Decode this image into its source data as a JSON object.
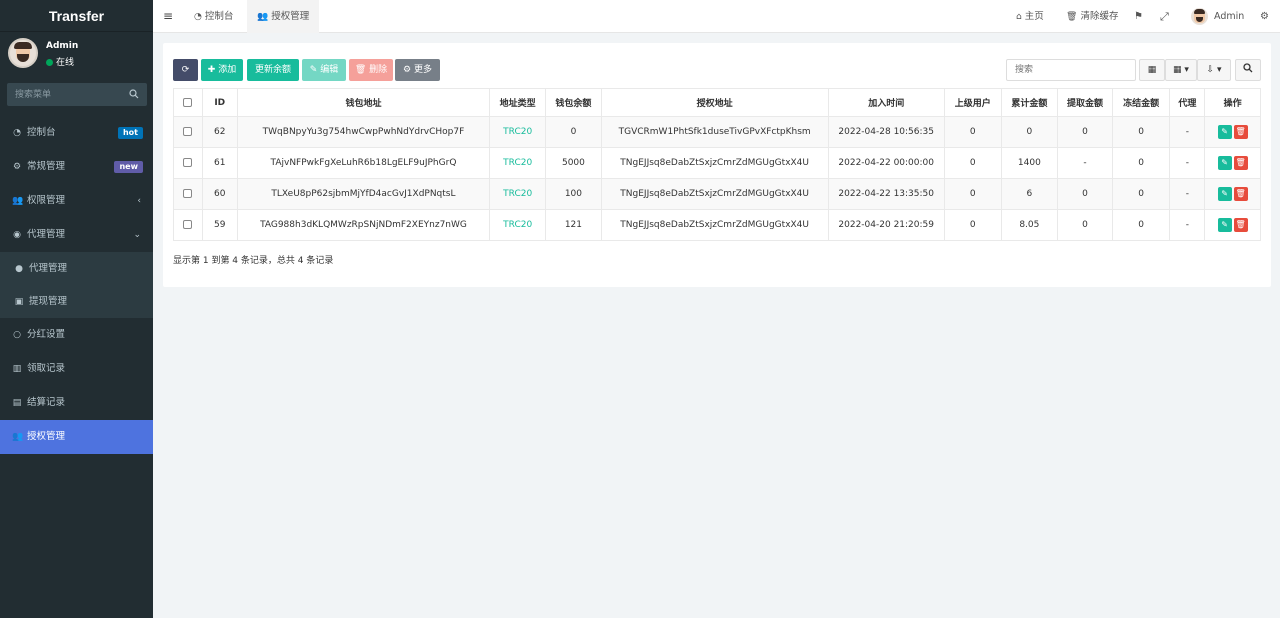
{
  "app": {
    "title": "Transfer"
  },
  "user": {
    "name": "Admin",
    "status": "在线"
  },
  "sidebar": {
    "search_placeholder": "搜索菜单",
    "items": [
      {
        "label": "控制台",
        "icon": "dashboard-icon",
        "badge": "hot",
        "badge_color": "#0073b7"
      },
      {
        "label": "常规管理",
        "icon": "cogs-icon",
        "badge": "new",
        "badge_color": "#605ca8"
      },
      {
        "label": "权限管理",
        "icon": "users-icon",
        "arrow": "‹"
      },
      {
        "label": "代理管理",
        "icon": "user-circle-icon",
        "arrow": "⌄"
      },
      {
        "label": "代理管理",
        "icon": "user-icon",
        "sub": true
      },
      {
        "label": "提现管理",
        "icon": "money-icon",
        "sub": true
      },
      {
        "label": "分红设置",
        "icon": "circle-icon"
      },
      {
        "label": "领取记录",
        "icon": "tasks-icon"
      },
      {
        "label": "结算记录",
        "icon": "list-icon"
      },
      {
        "label": "授权管理",
        "icon": "users-icon",
        "active": true
      }
    ]
  },
  "topbar": {
    "tabs": [
      {
        "label": "控制台"
      },
      {
        "label": "授权管理"
      }
    ],
    "right": {
      "home": "主页",
      "clear_cache": "清除缓存",
      "admin": "Admin"
    }
  },
  "toolbar": {
    "add": "添加",
    "update_balance": "更新余额",
    "edit": "编辑",
    "delete": "删除",
    "more": "更多",
    "search_placeholder": "搜索"
  },
  "table": {
    "columns": [
      "ID",
      "钱包地址",
      "地址类型",
      "钱包余额",
      "授权地址",
      "加入时间",
      "上级用户",
      "累计金额",
      "提取金额",
      "冻结金额",
      "代理",
      "操作"
    ],
    "rows": [
      {
        "id": "62",
        "wallet": "TWqBNpyYu3g754hwCwpPwhNdYdrvCHop7F",
        "type": "TRC20",
        "balance": "0",
        "auth": "TGVCRmW1PhtSfk1duseTivGPvXFctpKhsm",
        "time": "2022-04-28 10:56:35",
        "parent": "0",
        "total": "0",
        "withdrawn": "0",
        "frozen": "0",
        "agent": "-"
      },
      {
        "id": "61",
        "wallet": "TAjvNFPwkFgXeLuhR6b18LgELF9uJPhGrQ",
        "type": "TRC20",
        "balance": "5000",
        "auth": "TNgEJJsq8eDabZtSxjzCmrZdMGUgGtxX4U",
        "time": "2022-04-22 00:00:00",
        "parent": "0",
        "total": "1400",
        "withdrawn": "-",
        "frozen": "0",
        "agent": "-"
      },
      {
        "id": "60",
        "wallet": "TLXeU8pP62sjbmMjYfD4acGvJ1XdPNqtsL",
        "type": "TRC20",
        "balance": "100",
        "auth": "TNgEJJsq8eDabZtSxjzCmrZdMGUgGtxX4U",
        "time": "2022-04-22 13:35:50",
        "parent": "0",
        "total": "6",
        "withdrawn": "0",
        "frozen": "0",
        "agent": "-"
      },
      {
        "id": "59",
        "wallet": "TAG988h3dKLQMWzRpSNjNDmF2XEYnz7nWG",
        "type": "TRC20",
        "balance": "121",
        "auth": "TNgEJJsq8eDabZtSxjzCmrZdMGUgGtxX4U",
        "time": "2022-04-20 21:20:59",
        "parent": "0",
        "total": "8.05",
        "withdrawn": "0",
        "frozen": "0",
        "agent": "-"
      }
    ],
    "footer": "显示第 1 到第 4 条记录，总共 4 条记录"
  }
}
